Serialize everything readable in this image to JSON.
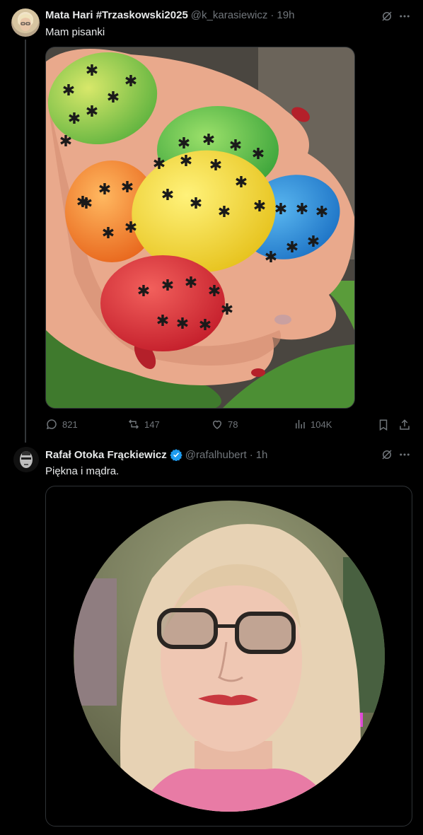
{
  "tweet1": {
    "author_name": "Mata Hari #Trzaskowski2025",
    "handle": "@k_karasiewicz",
    "separator": "·",
    "time": "19h",
    "text": "Mam pisanki",
    "image_icon": "easter-eggs-photo",
    "stats": {
      "replies": "821",
      "reposts": "147",
      "likes": "78",
      "views": "104K"
    }
  },
  "tweet2": {
    "author_name": "Rafał Otoka Frąckiewicz",
    "verified_icon": "verified-badge-icon",
    "handle": "@rafalhubert",
    "separator": "·",
    "time": "1h",
    "text": "Piękna i mądra.",
    "image_icon": "portrait-photo"
  },
  "colors": {
    "background": "#000000",
    "text": "#e7e9ea",
    "muted": "#71767b",
    "verified": "#1d9bf0",
    "border": "#2f3336"
  }
}
